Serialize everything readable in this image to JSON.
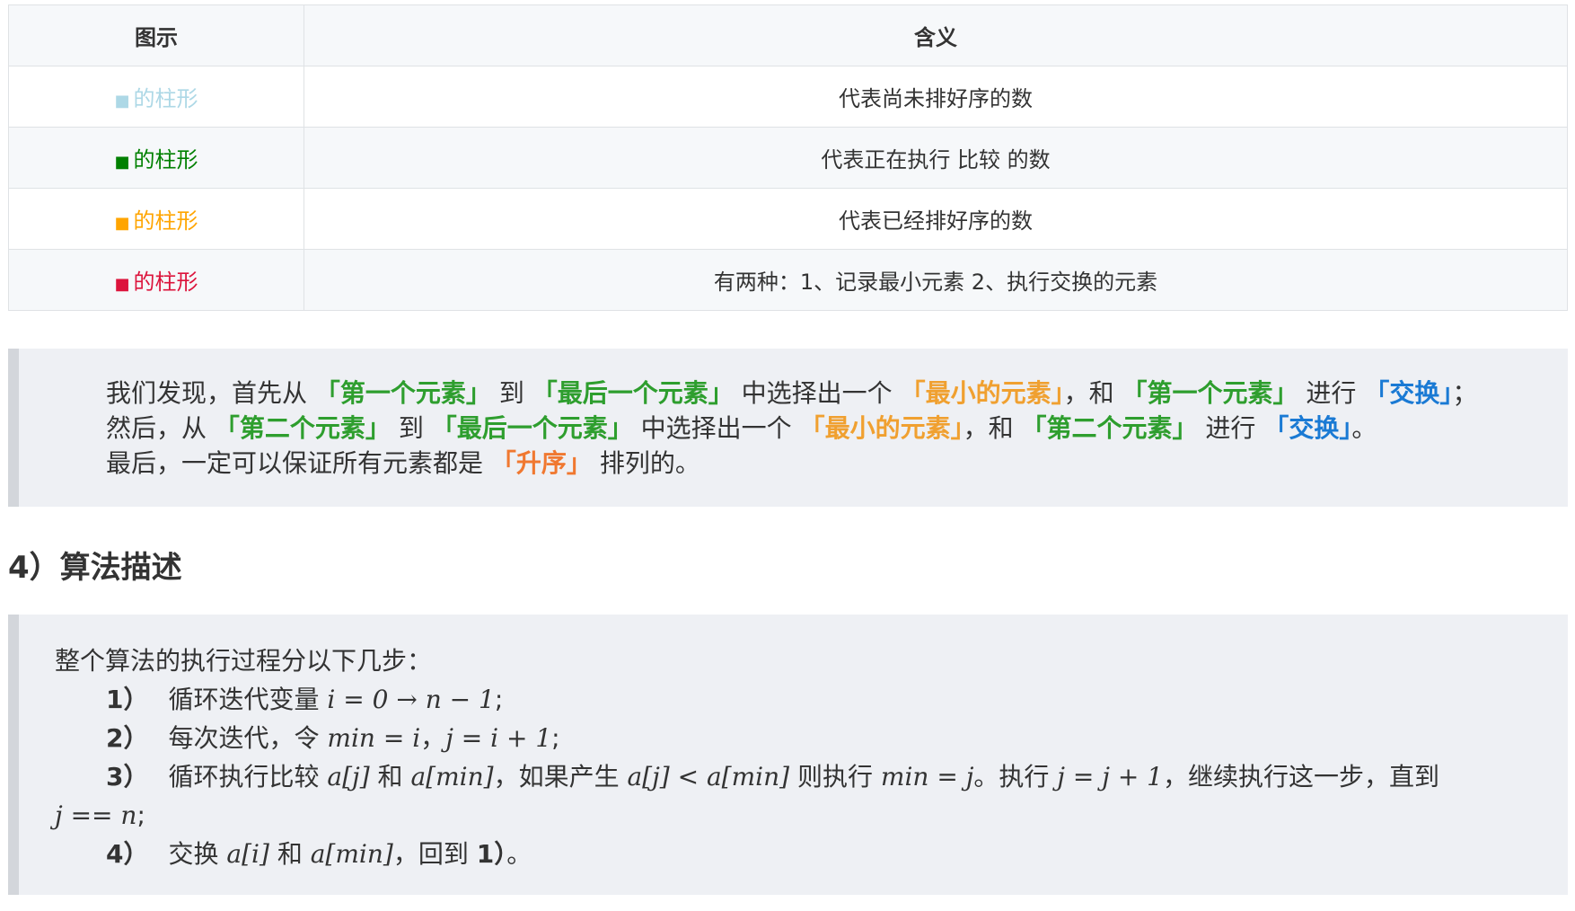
{
  "table": {
    "headers": [
      "图示",
      "含义"
    ],
    "rows": [
      {
        "square": "■",
        "label": "的柱形",
        "color": "#add8e6",
        "meaning": "代表尚未排好序的数"
      },
      {
        "square": "■",
        "label": "的柱形",
        "color": "#008000",
        "meaning": "代表正在执行 比较 的数"
      },
      {
        "square": "■",
        "label": "的柱形",
        "color": "#ffa500",
        "meaning": "代表已经排好序的数"
      },
      {
        "square": "■",
        "label": "的柱形",
        "color": "#dc143c",
        "meaning": "有两种：1、记录最小元素 2、执行交换的元素"
      }
    ]
  },
  "colors": {
    "green": "#2e9e2e",
    "orange": "#f0a030",
    "blue": "#1a7ad4",
    "coral": "#f07830"
  },
  "paragraph": {
    "line1": [
      {
        "t": "我们发现，首先从 ",
        "c": ""
      },
      {
        "t": "「第一个元素」",
        "c": "green"
      },
      {
        "t": " 到 ",
        "c": ""
      },
      {
        "t": "「最后一个元素」",
        "c": "green"
      },
      {
        "t": " 中选择出一个 ",
        "c": ""
      },
      {
        "t": "「最小的元素」",
        "c": "orange"
      },
      {
        "t": "，和 ",
        "c": ""
      },
      {
        "t": "「第一个元素」",
        "c": "green"
      },
      {
        "t": " 进行 ",
        "c": ""
      },
      {
        "t": "「交换」",
        "c": "blue"
      },
      {
        "t": "；",
        "c": ""
      }
    ],
    "line2": [
      {
        "t": "然后，从 ",
        "c": ""
      },
      {
        "t": "「第二个元素」",
        "c": "green"
      },
      {
        "t": " 到 ",
        "c": ""
      },
      {
        "t": "「最后一个元素」",
        "c": "green"
      },
      {
        "t": " 中选择出一个 ",
        "c": ""
      },
      {
        "t": "「最小的元素」",
        "c": "orange"
      },
      {
        "t": "，和 ",
        "c": ""
      },
      {
        "t": "「第二个元素」",
        "c": "green"
      },
      {
        "t": " 进行 ",
        "c": ""
      },
      {
        "t": "「交换」",
        "c": "blue"
      },
      {
        "t": "。",
        "c": ""
      }
    ],
    "line3": [
      {
        "t": "最后，一定可以保证所有元素都是 ",
        "c": ""
      },
      {
        "t": "「升序」",
        "c": "coral"
      },
      {
        "t": " 排列的。",
        "c": ""
      }
    ]
  },
  "section": {
    "heading": "4）算法描述"
  },
  "steps": {
    "intro": "整个算法的执行过程分以下几步：",
    "s1": {
      "num": "1）",
      "text": "循环迭代变量",
      "math": "i = 0 → n − 1",
      "end": ";"
    },
    "s2": {
      "num": "2）",
      "text": "每次迭代，令",
      "math1": "min = i",
      "sep": "，",
      "math2": "j = i + 1",
      "end": ";"
    },
    "s3": {
      "num": "3）",
      "t1": "循环执行比较",
      "m1": "a[j]",
      "t2": "和",
      "m2": "a[min]",
      "t3": "，如果产生",
      "m3": "a[j] < a[min]",
      "t4": "则执行",
      "m4": "min = j",
      "t5": "。执行",
      "m5": "j = j + 1",
      "t6": "，继续执行这一步，直到",
      "m6": "j == n",
      "end": ";"
    },
    "s4": {
      "num": "4）",
      "t1": "交换",
      "m1": "a[i]",
      "t2": "和",
      "m2": "a[min]",
      "t3": "，回到",
      "ref": "1）",
      "end": "。"
    }
  }
}
